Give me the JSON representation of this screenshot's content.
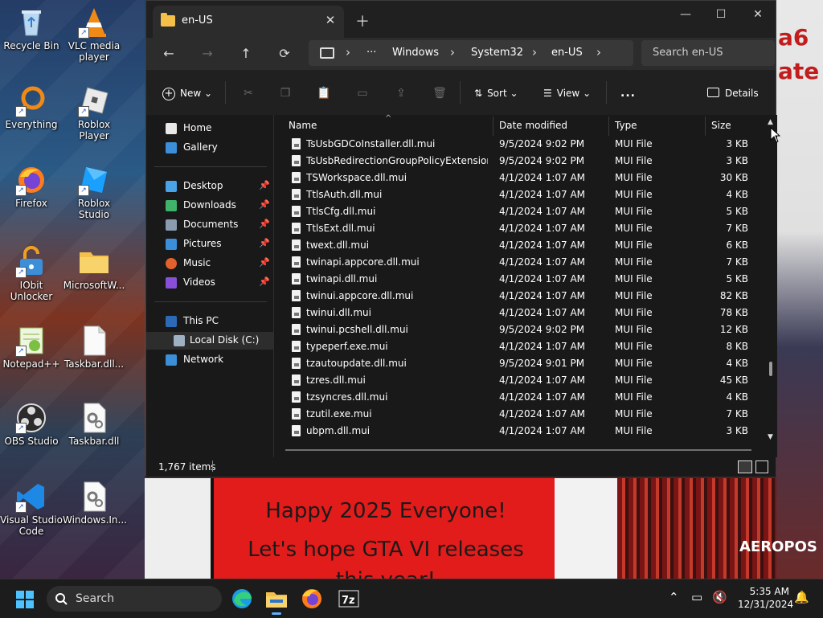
{
  "desktop": {
    "icons": [
      {
        "label": "Recycle Bin"
      },
      {
        "label": "VLC media player"
      },
      {
        "label": "Everything"
      },
      {
        "label": "Roblox Player"
      },
      {
        "label": "Firefox"
      },
      {
        "label": "Roblox Studio"
      },
      {
        "label": "IObit Unlocker"
      },
      {
        "label": "MicrosoftW..."
      },
      {
        "label": "Notepad++"
      },
      {
        "label": "Taskbar.dll..."
      },
      {
        "label": "OBS Studio"
      },
      {
        "label": "Taskbar.dll"
      },
      {
        "label": "Visual Studio Code"
      },
      {
        "label": "Windows.In..."
      }
    ],
    "wallpaper": {
      "banner_line1": "Happy 2025 Everyone!",
      "banner_line2": "Let's hope GTA VI releases",
      "banner_line3": "this year!",
      "right_text_1": "a6",
      "right_text_2": "ate",
      "crowd_text": "AEROPOS"
    }
  },
  "window": {
    "tab_title": "en-US",
    "new_tab_icon": "plus-icon",
    "breadcrumbs": [
      "Windows",
      "System32",
      "en-US"
    ],
    "search_placeholder": "Search en-US",
    "toolbar": {
      "new_label": "New",
      "sort_label": "Sort",
      "view_label": "View",
      "more_label": "...",
      "details_label": "Details"
    },
    "nav": {
      "home": "Home",
      "gallery": "Gallery",
      "desktop": "Desktop",
      "downloads": "Downloads",
      "documents": "Documents",
      "pictures": "Pictures",
      "music": "Music",
      "videos": "Videos",
      "this_pc": "This PC",
      "local_disk": "Local Disk (C:)",
      "network": "Network"
    },
    "columns": {
      "name": "Name",
      "date": "Date modified",
      "type": "Type",
      "size": "Size"
    },
    "files": [
      {
        "name": "TsUsbGDCoInstaller.dll.mui",
        "date": "9/5/2024 9:02 PM",
        "type": "MUI File",
        "size": "3 KB"
      },
      {
        "name": "TsUsbRedirectionGroupPolicyExtension.d...",
        "date": "9/5/2024 9:02 PM",
        "type": "MUI File",
        "size": "3 KB"
      },
      {
        "name": "TSWorkspace.dll.mui",
        "date": "4/1/2024 1:07 AM",
        "type": "MUI File",
        "size": "30 KB"
      },
      {
        "name": "TtlsAuth.dll.mui",
        "date": "4/1/2024 1:07 AM",
        "type": "MUI File",
        "size": "4 KB"
      },
      {
        "name": "TtlsCfg.dll.mui",
        "date": "4/1/2024 1:07 AM",
        "type": "MUI File",
        "size": "5 KB"
      },
      {
        "name": "TtlsExt.dll.mui",
        "date": "4/1/2024 1:07 AM",
        "type": "MUI File",
        "size": "7 KB"
      },
      {
        "name": "twext.dll.mui",
        "date": "4/1/2024 1:07 AM",
        "type": "MUI File",
        "size": "6 KB"
      },
      {
        "name": "twinapi.appcore.dll.mui",
        "date": "4/1/2024 1:07 AM",
        "type": "MUI File",
        "size": "7 KB"
      },
      {
        "name": "twinapi.dll.mui",
        "date": "4/1/2024 1:07 AM",
        "type": "MUI File",
        "size": "5 KB"
      },
      {
        "name": "twinui.appcore.dll.mui",
        "date": "4/1/2024 1:07 AM",
        "type": "MUI File",
        "size": "82 KB"
      },
      {
        "name": "twinui.dll.mui",
        "date": "4/1/2024 1:07 AM",
        "type": "MUI File",
        "size": "78 KB"
      },
      {
        "name": "twinui.pcshell.dll.mui",
        "date": "9/5/2024 9:02 PM",
        "type": "MUI File",
        "size": "12 KB"
      },
      {
        "name": "typeperf.exe.mui",
        "date": "4/1/2024 1:07 AM",
        "type": "MUI File",
        "size": "8 KB"
      },
      {
        "name": "tzautoupdate.dll.mui",
        "date": "9/5/2024 9:01 PM",
        "type": "MUI File",
        "size": "4 KB"
      },
      {
        "name": "tzres.dll.mui",
        "date": "4/1/2024 1:07 AM",
        "type": "MUI File",
        "size": "45 KB"
      },
      {
        "name": "tzsyncres.dll.mui",
        "date": "4/1/2024 1:07 AM",
        "type": "MUI File",
        "size": "4 KB"
      },
      {
        "name": "tzutil.exe.mui",
        "date": "4/1/2024 1:07 AM",
        "type": "MUI File",
        "size": "7 KB"
      },
      {
        "name": "ubpm.dll.mui",
        "date": "4/1/2024 1:07 AM",
        "type": "MUI File",
        "size": "3 KB"
      }
    ],
    "status_count": "1,767 items"
  },
  "taskbar": {
    "search_label": "Search",
    "time": "5:35 AM",
    "date": "12/31/2024",
    "apps": [
      "edge-icon",
      "file-explorer-icon",
      "firefox-icon",
      "7zip-icon"
    ]
  },
  "colors": {
    "window_bg": "#191919",
    "accent": "#60b0ff",
    "folder": "#f5c04a"
  }
}
